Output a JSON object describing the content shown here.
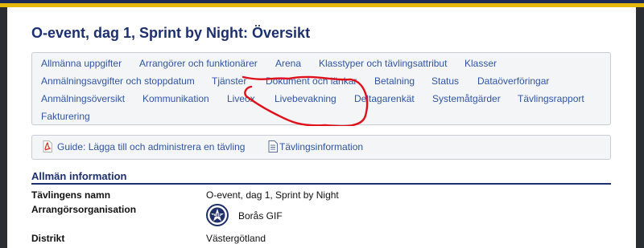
{
  "title": "O-event, dag 1, Sprint by Night: Översikt",
  "nav": {
    "row1": [
      "Allmänna uppgifter",
      "Arrangörer och funktionärer",
      "Arena",
      "Klasstyper och tävlingsattribut",
      "Klasser"
    ],
    "row2": [
      "Anmälningsavgifter och stoppdatum",
      "Tjänster",
      "Dokument och länkar",
      "Betalning",
      "Status",
      "Dataöverföringar"
    ],
    "row3": [
      "Anmälningsöversikt",
      "Kommunikation",
      "Liveox",
      "Livebevakning",
      "Deltagarenkät",
      "Systemåtgärder",
      "Tävlingsrapport"
    ],
    "row4": [
      "Fakturering"
    ]
  },
  "annotation_color": "#e0101a",
  "links": {
    "guide": "Guide: Lägga till och administrera en tävling",
    "info": "Tävlingsinformation",
    "pdf_icon": "pdf-icon",
    "info_icon": "document-icon"
  },
  "section": {
    "title": "Allmän information",
    "rows": [
      {
        "label": "Tävlingens namn",
        "value": "O-event, dag 1, Sprint by Night"
      },
      {
        "label": "Arrangörsorganisation",
        "value": "Borås GIF"
      },
      {
        "label": "Distrikt",
        "value": "Västergötland"
      }
    ],
    "logo_text": "GIF"
  },
  "colors": {
    "heading": "#1c2f6e",
    "link": "#2f55a4",
    "top_stripe": "#e2b80d"
  }
}
